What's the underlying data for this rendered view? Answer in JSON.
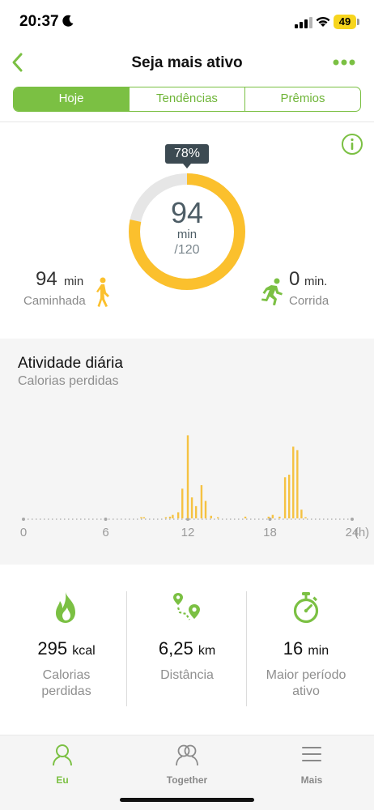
{
  "status_bar": {
    "time": "20:37",
    "battery": "49"
  },
  "nav": {
    "title": "Seja mais ativo"
  },
  "tabs": [
    {
      "label": "Hoje",
      "active": true
    },
    {
      "label": "Tendências",
      "active": false
    },
    {
      "label": "Prêmios",
      "active": false
    }
  ],
  "summary": {
    "percent_label": "78%",
    "progress_fraction": 0.783,
    "minutes": "94",
    "minutes_unit": "min",
    "goal": "/120",
    "walking": {
      "value": "94",
      "unit": "min",
      "label": "Caminhada"
    },
    "running": {
      "value": "0",
      "unit": "min.",
      "label": "Corrida"
    }
  },
  "daily_activity": {
    "title": "Atividade diária",
    "subtitle": "Calorias perdidas"
  },
  "chart_data": {
    "type": "bar",
    "xlabel": "",
    "ylabel": "",
    "x_ticks": [
      "0",
      "6",
      "12",
      "18",
      "24"
    ],
    "x_unit": "(h)",
    "xlim": [
      0,
      24
    ],
    "ylim": [
      0,
      100
    ],
    "x": [
      8.6,
      8.8,
      10.4,
      10.7,
      10.9,
      11.3,
      11.6,
      12.0,
      12.3,
      12.6,
      13.0,
      13.3,
      13.7,
      14.2,
      16.2,
      17.9,
      18.2,
      18.7,
      19.1,
      19.4,
      19.7,
      20.0,
      20.3,
      20.6
    ],
    "values": [
      1,
      1,
      1,
      2,
      4,
      7,
      34,
      95,
      24,
      14,
      38,
      20,
      3,
      1,
      2,
      2,
      4,
      2,
      47,
      50,
      82,
      78,
      10,
      1
    ]
  },
  "stats": [
    {
      "icon": "flame-icon",
      "value": "295",
      "unit": "kcal",
      "label_line1": "Calorias",
      "label_line2": "perdidas"
    },
    {
      "icon": "route-pin-icon",
      "value": "6,25",
      "unit": "km",
      "label_line1": "Distância",
      "label_line2": ""
    },
    {
      "icon": "stopwatch-icon",
      "value": "16",
      "unit": "min",
      "label_line1": "Maior período",
      "label_line2": "ativo"
    }
  ],
  "tab_bar": [
    {
      "label": "Eu",
      "icon": "person-icon",
      "active": true
    },
    {
      "label": "Together",
      "icon": "people-icon",
      "active": false
    },
    {
      "label": "Mais",
      "icon": "menu-icon",
      "active": false
    }
  ],
  "colors": {
    "accent_green": "#7bc043",
    "ring_yellow": "#fbc02d",
    "ring_track": "#e6e6e6",
    "bar_yellow": "#f5c242"
  }
}
